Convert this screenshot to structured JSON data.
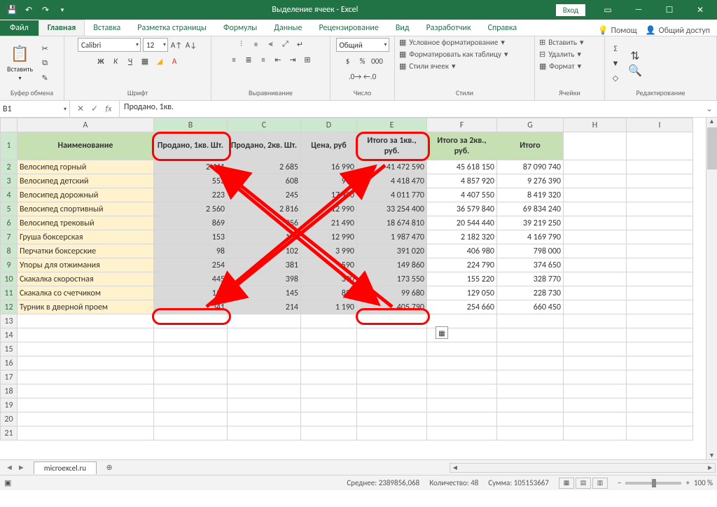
{
  "titlebar": {
    "title": "Выделение ячеек  -  Excel",
    "signin": "Вход"
  },
  "tabs": {
    "file": "Файл",
    "items": [
      "Главная",
      "Вставка",
      "Разметка страницы",
      "Формулы",
      "Данные",
      "Рецензирование",
      "Вид",
      "Разработчик",
      "Справка"
    ],
    "active": 0,
    "help": "Помощ",
    "share": "Общий доступ"
  },
  "ribbon": {
    "clipboard": {
      "label": "Буфер обмена",
      "paste": "Вставить"
    },
    "font": {
      "label": "Шрифт",
      "name": "Calibri",
      "size": "12",
      "b": "Ж",
      "i": "К",
      "u": "Ч"
    },
    "align": {
      "label": "Выравнивание"
    },
    "number": {
      "label": "Число",
      "format": "Общий"
    },
    "styles": {
      "label": "Стили",
      "cond": "Условное форматирование",
      "table": "Форматировать как таблицу",
      "cell": "Стили ячеек"
    },
    "cells": {
      "label": "Ячейки",
      "ins": "Вставить",
      "del": "Удалить",
      "fmt": "Формат"
    },
    "editing": {
      "label": "Редактирование"
    }
  },
  "fx": {
    "name": "B1",
    "formula": "Продано, 1кв."
  },
  "cols": [
    "A",
    "B",
    "C",
    "D",
    "E",
    "F",
    "G",
    "H",
    "I"
  ],
  "headers": [
    "Наименование",
    "Продано, 1кв. Шт.",
    "Продано, 2кв. Шт.",
    "Цена, руб",
    "Итого за 1кв., руб.",
    "Итого за 2кв., руб.",
    "Итого"
  ],
  "rows": [
    {
      "r": 2,
      "n": "Велосипед горный",
      "b": "2 441",
      "c": "2 685",
      "d": "16 990",
      "e": "41 472 590",
      "f": "45 618 150",
      "g": "87 090 740"
    },
    {
      "r": 3,
      "n": "Велосипед детский",
      "b": "553",
      "c": "608",
      "d": "990",
      "e": "4 418 470",
      "f": "4 857 920",
      "g": "9 276 390"
    },
    {
      "r": 4,
      "n": "Велосипед дорожный",
      "b": "223",
      "c": "245",
      "d": "17 990",
      "e": "4 011 770",
      "f": "4 407 550",
      "g": "8 419 320"
    },
    {
      "r": 5,
      "n": "Велосипед спортивный",
      "b": "2 560",
      "c": "2 816",
      "d": "12 990",
      "e": "33 254 400",
      "f": "36 579 840",
      "g": "69 834 240"
    },
    {
      "r": 6,
      "n": "Велосипед трековый",
      "b": "869",
      "c": "956",
      "d": "21 490",
      "e": "18 674 810",
      "f": "20 544 440",
      "g": "39 219 250"
    },
    {
      "r": 7,
      "n": "Груша боксерская",
      "b": "153",
      "c": "168",
      "d": "12 990",
      "e": "1 987 470",
      "f": "2 182 320",
      "g": "4 169 790"
    },
    {
      "r": 8,
      "n": "Перчатки боксерские",
      "b": "98",
      "c": "102",
      "d": "3 990",
      "e": "391 020",
      "f": "406 980",
      "g": "798 000"
    },
    {
      "r": 9,
      "n": "Упоры для отжимания",
      "b": "254",
      "c": "381",
      "d": "590",
      "e": "149 860",
      "f": "224 790",
      "g": "374 650"
    },
    {
      "r": 10,
      "n": "Скакалка скоростная",
      "b": "445",
      "c": "398",
      "d": "390",
      "e": "173 550",
      "f": "155 220",
      "g": "328 770"
    },
    {
      "r": 11,
      "n": "Скакалка со счетчиком",
      "b": "112",
      "c": "145",
      "d": "890",
      "e": "99 680",
      "f": "129 050",
      "g": "228 730"
    },
    {
      "r": 12,
      "n": "Турник в дверной проем",
      "b": "341",
      "c": "214",
      "d": "1 190",
      "e": "405 790",
      "f": "254 660",
      "g": "660 450"
    }
  ],
  "emptyRows": [
    13,
    14,
    15,
    16,
    17,
    18,
    19,
    20,
    21
  ],
  "sheet": {
    "name": "microexcel.ru"
  },
  "status": {
    "avg_lbl": "Среднее:",
    "avg": "2389856,068",
    "cnt_lbl": "Количество:",
    "cnt": "48",
    "sum_lbl": "Сумма:",
    "sum": "105153667",
    "zoom": "100 %"
  }
}
